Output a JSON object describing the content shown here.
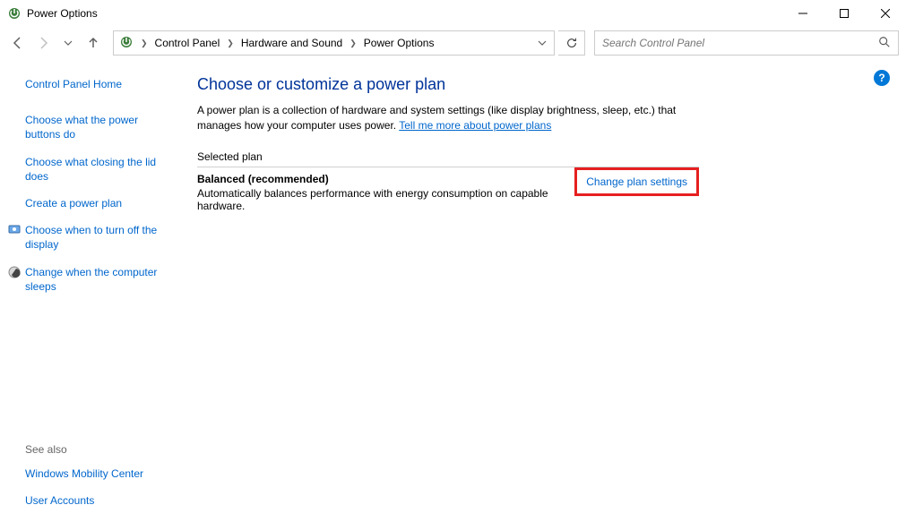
{
  "window": {
    "title": "Power Options"
  },
  "breadcrumb": {
    "items": [
      "Control Panel",
      "Hardware and Sound",
      "Power Options"
    ]
  },
  "search": {
    "placeholder": "Search Control Panel"
  },
  "sidebar": {
    "home": "Control Panel Home",
    "links": [
      "Choose what the power buttons do",
      "Choose what closing the lid does",
      "Create a power plan",
      "Choose when to turn off the display",
      "Change when the computer sleeps"
    ],
    "see_also_label": "See also",
    "see_also": [
      "Windows Mobility Center",
      "User Accounts"
    ]
  },
  "main": {
    "heading": "Choose or customize a power plan",
    "description_pre": "A power plan is a collection of hardware and system settings (like display brightness, sleep, etc.) that manages how your computer uses power. ",
    "description_link": "Tell me more about power plans",
    "section_label": "Selected plan",
    "plan_name": "Balanced (recommended)",
    "plan_desc": "Automatically balances performance with energy consumption on capable hardware.",
    "change_link": "Change plan settings"
  }
}
